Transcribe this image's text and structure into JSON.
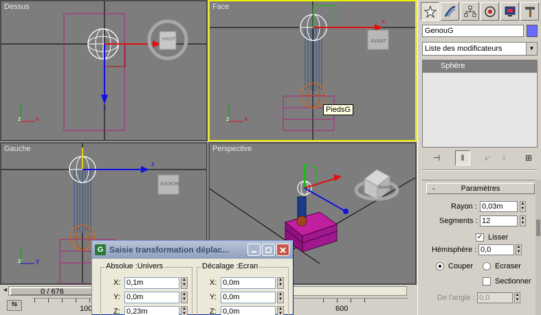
{
  "viewports": {
    "top_left": {
      "label": "Dessus",
      "cube_label": "HAUT"
    },
    "top_right": {
      "label": "Face",
      "cube_label": "AVANT",
      "tooltip": "PiedsG"
    },
    "bottom_left": {
      "label": "Gauche",
      "cube_label": "GAUCHE"
    },
    "bottom_right": {
      "label": "Perspective",
      "cube_label": "AVANT"
    }
  },
  "timeline": {
    "frame_display": "0 / 676",
    "ticks": [
      "0",
      "100",
      "600"
    ]
  },
  "panel": {
    "object_name": "GenouG",
    "object_color": "#6a6aff",
    "modifier_list": "Liste des modificateurs",
    "stack_items": [
      "Sphère"
    ],
    "rollout_title": "Paramètres",
    "rollout_sign": "-",
    "rayon_label": "Rayon :",
    "rayon_value": "0,03m",
    "segments_label": "Segments :",
    "segments_value": "12",
    "lisser_label": "Lisser",
    "lisser_checked": true,
    "hemisphere_label": "Hémisphère :",
    "hemisphere_value": "0,0",
    "couper_label": "Couper",
    "ecraser_label": "Ecraser",
    "sectionner_label": "Sectionner",
    "angle_label": "De l'angle :",
    "angle_value": "0,0"
  },
  "dialog": {
    "title": "Saisie transformation déplac...",
    "absolute_group": "Absolue :Univers",
    "offset_group": "Décalage :Ecran",
    "absolute": {
      "x": "0,1m",
      "y": "0,0m",
      "z": "0,23m"
    },
    "offset": {
      "x": "0,0m",
      "y": "0,0m",
      "z": "0,0m"
    },
    "x_label": "X:",
    "y_label": "Y:",
    "z_label": "Z:"
  }
}
